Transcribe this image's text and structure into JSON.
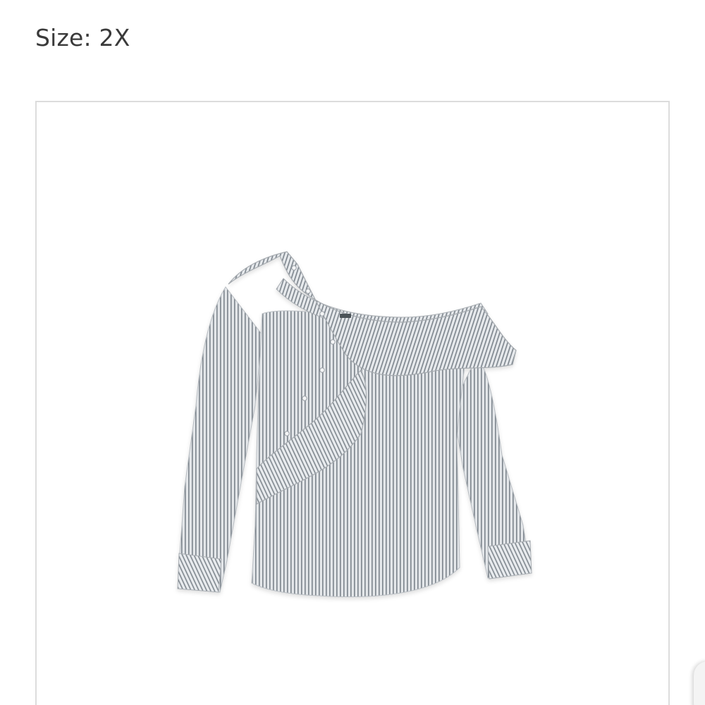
{
  "size": {
    "label": "Size: 2X"
  },
  "product_image": {
    "icon": "striped-ruffle-blouse-photo",
    "colors": {
      "fabric": "#c9cdd1",
      "stripe": "#6f7780",
      "frame_border": "#dcdcdc"
    }
  }
}
